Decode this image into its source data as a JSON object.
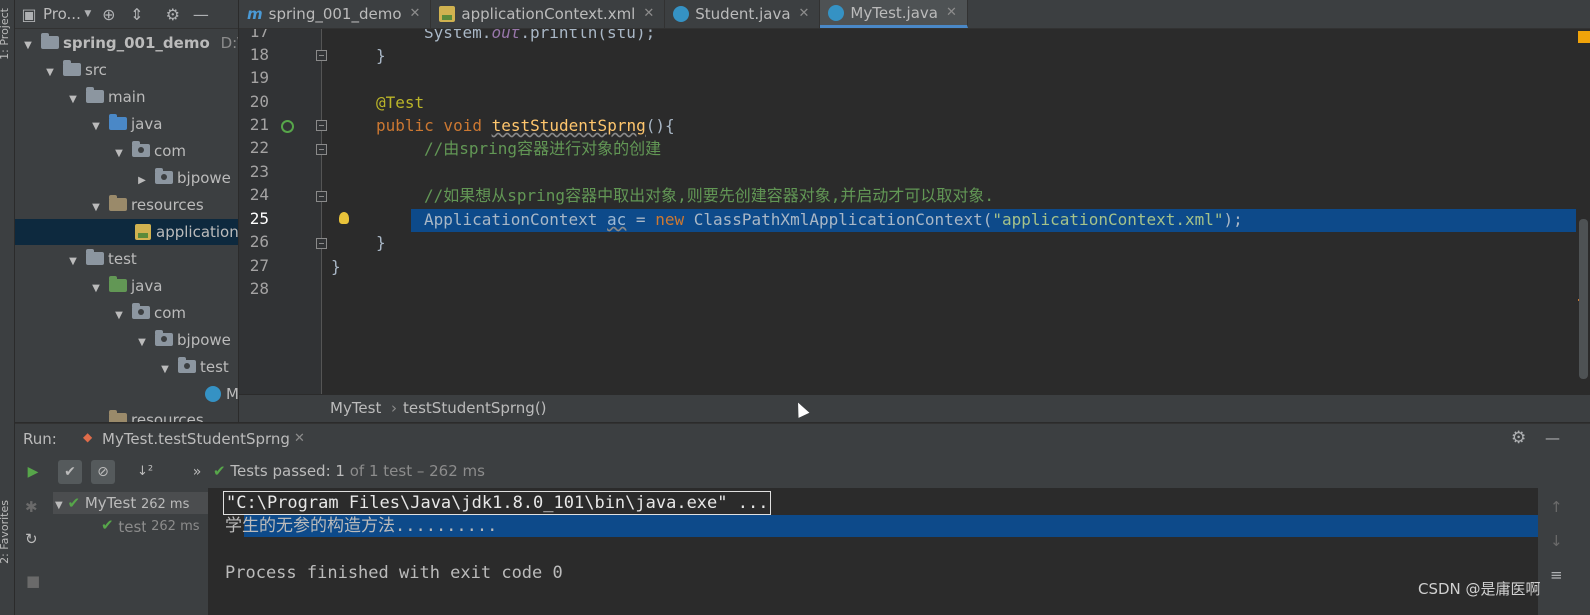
{
  "toolwindows": {
    "project_label": "1: Project",
    "favorites_label": "2: Favorites"
  },
  "project": {
    "view_label": "Pro...",
    "tree": [
      {
        "label": "spring_001_demo",
        "path_hint": "D:\\co"
      },
      {
        "label": "src"
      },
      {
        "label": "main"
      },
      {
        "label": "java"
      },
      {
        "label": "com"
      },
      {
        "label": "bjpowe"
      },
      {
        "label": "resources"
      },
      {
        "label": "application"
      },
      {
        "label": "test"
      },
      {
        "label": "java"
      },
      {
        "label": "com"
      },
      {
        "label": "bjpowe"
      },
      {
        "label": "test"
      },
      {
        "label": "M"
      },
      {
        "label": "resources"
      }
    ]
  },
  "tabs": [
    {
      "label": "spring_001_demo",
      "icon": "module-m-icon"
    },
    {
      "label": "applicationContext.xml",
      "icon": "xml-file-icon"
    },
    {
      "label": "Student.java",
      "icon": "class-icon"
    },
    {
      "label": "MyTest.java",
      "icon": "test-class-icon",
      "active": true
    }
  ],
  "editor": {
    "line_numbers": [
      "17",
      "18",
      "19",
      "20",
      "21",
      "22",
      "23",
      "24",
      "25",
      "26",
      "27",
      "28"
    ],
    "code": {
      "l17_a": "System.",
      "l17_b": "out",
      "l17_c": ".println(stu);",
      "l18": "}",
      "l20": "@Test",
      "l21_kw": "public void ",
      "l21_fn": "testStudentSprng",
      "l21_rest": "(){",
      "l22": "//由spring容器进行对象的创建",
      "l24": "//如果想从spring容器中取出对象,则要先创建容器对象,并启动才可以取对象.",
      "l25_type": "ApplicationContext ",
      "l25_var": "ac",
      "l25_eq": " = ",
      "l25_new": "new ",
      "l25_cls": "ClassPathXmlApplicationContext(",
      "l25_str": "\"applicationContext.xml\"",
      "l25_end": ");",
      "l26": "}",
      "l27": "}"
    },
    "highlighted_line": 25
  },
  "breadcrumb": {
    "class": "MyTest",
    "sep": "›",
    "method": "testStudentSprng()"
  },
  "run": {
    "label": "Run:",
    "tab_label": "MyTest.testStudentSprng",
    "status_prefix": "Tests passed:",
    "status_value": "1",
    "status_suffix": "of 1 test – 262 ms",
    "tree": [
      {
        "label": "MyTest",
        "time": "262 ms"
      },
      {
        "label": "test",
        "time": "262 ms"
      }
    ],
    "console": [
      "\"C:\\Program Files\\Java\\jdk1.8.0_101\\bin\\java.exe\" ...",
      "学生的无参的构造方法..........",
      "",
      "Process finished with exit code 0"
    ]
  },
  "watermark": "CSDN @是庸医啊",
  "colors": {
    "selection": "#0d4a8a",
    "accent": "#4a88c7",
    "passed": "#57a64a"
  }
}
